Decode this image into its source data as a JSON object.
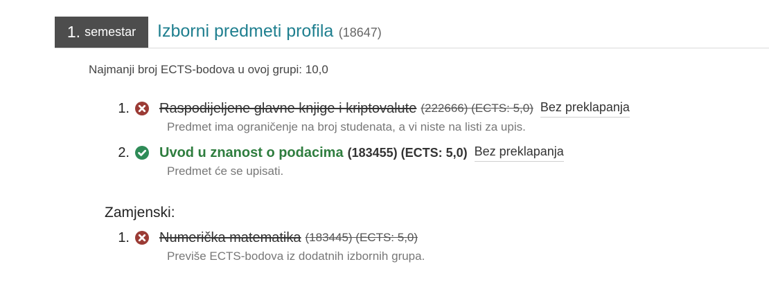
{
  "header": {
    "semester_number": "1.",
    "semester_label": "semestar",
    "group_name": "Izborni predmeti profila",
    "group_code": "(18647)"
  },
  "min_ects_text": "Najmanji broj ECTS-bodova u ovoj grupi: 10,0",
  "items": [
    {
      "number": "1.",
      "status": "rejected",
      "name": "Raspodijeljene glavne knjige i kriptovalute",
      "meta": "(222666) (ECTS: 5,0)",
      "link": "Bez preklapanja",
      "note": "Predmet ima ograničenje na broj studenata, a vi niste na listi za upis."
    },
    {
      "number": "2.",
      "status": "accepted",
      "name": "Uvod u znanost o podacima",
      "meta": "(183455) (ECTS: 5,0)",
      "link": "Bez preklapanja",
      "note": "Predmet će se upisati."
    }
  ],
  "replacements": {
    "label": "Zamjenski:",
    "items": [
      {
        "number": "1.",
        "status": "rejected",
        "name": "Numerička matematika",
        "meta": "(183445) (ECTS: 5,0)",
        "note": "Previše ECTS-bodova iz dodatnih izbornih grupa."
      }
    ]
  },
  "colors": {
    "badge_bg": "#4d4d4d",
    "title": "#1f7f8f",
    "rejected": "#9b3b35",
    "accepted": "#2e8b57"
  },
  "icons": {
    "rejected": "times-circle-icon",
    "accepted": "check-circle-icon"
  }
}
